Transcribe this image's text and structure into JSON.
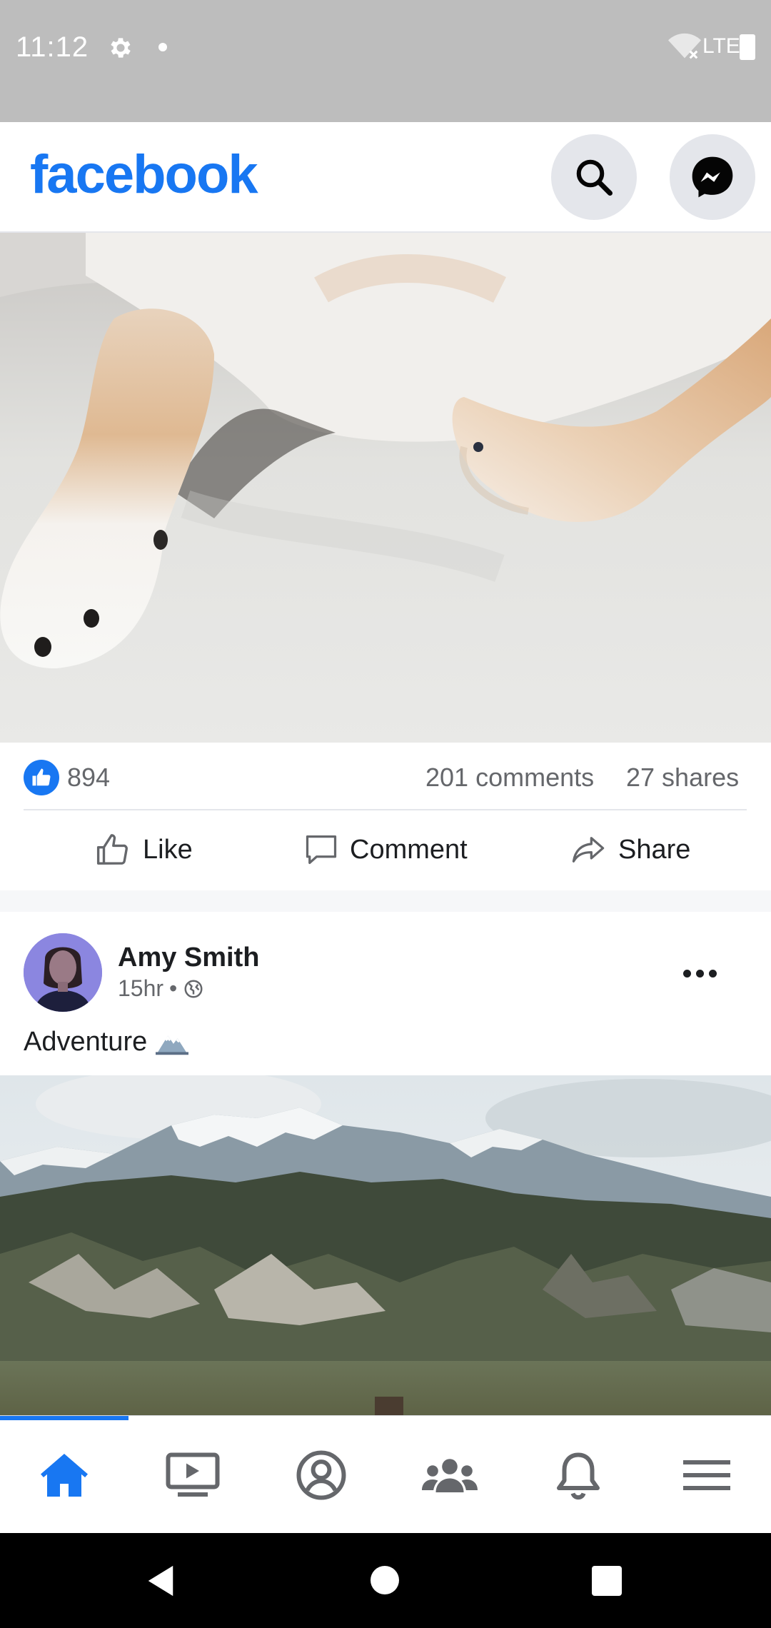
{
  "status_bar": {
    "time": "11:12",
    "network": "LTE",
    "icons": [
      "settings-icon",
      "notification-dot-icon",
      "wifi-off-icon",
      "battery-icon"
    ]
  },
  "app_bar": {
    "logo": "facebook",
    "logo_color": "#1877f2",
    "actions": [
      "search-icon",
      "messenger-icon"
    ]
  },
  "post1": {
    "image": "dog-paws-photo",
    "like_count": "894",
    "comments": "201 comments",
    "shares": "27 shares",
    "actions": {
      "like": "Like",
      "comment": "Comment",
      "share": "Share"
    }
  },
  "post2": {
    "author": "Amy Smith",
    "time": "15hr",
    "separator": "•",
    "privacy": "globe-icon",
    "text": "Adventure",
    "emoji": "snow-capped-mountain-icon",
    "image": "mountain-landscape-photo"
  },
  "bottom_nav": {
    "items": [
      "home-icon",
      "watch-icon",
      "profile-icon",
      "groups-icon",
      "notifications-icon",
      "menu-icon"
    ],
    "active": "home-icon"
  },
  "system_nav": [
    "back-icon",
    "home-circle-icon",
    "recents-icon"
  ]
}
